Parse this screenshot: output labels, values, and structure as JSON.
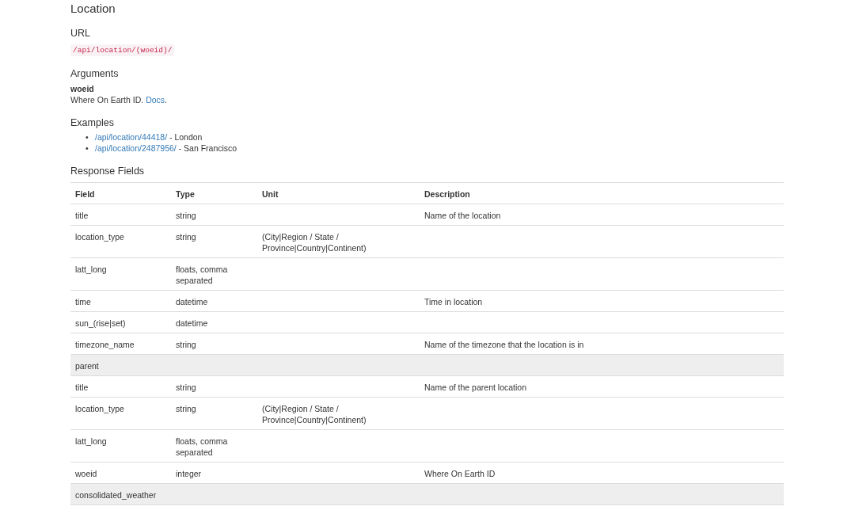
{
  "title": "Location",
  "url": {
    "heading": "URL",
    "path": "/api/location/(woeid)/"
  },
  "arguments": {
    "heading": "Arguments",
    "items": [
      {
        "name": "woeid",
        "description": "Where On Earth ID. ",
        "link": "Docs",
        "after": "."
      }
    ]
  },
  "examples": {
    "heading": "Examples",
    "items": [
      {
        "marker": "•",
        "link": "/api/location/44418/",
        "text": " - London"
      },
      {
        "marker": "•",
        "link": "/api/location/2487956/",
        "text": " - San Francisco"
      }
    ]
  },
  "response_fields": {
    "heading": "Response Fields",
    "columns": [
      "Field",
      "Type",
      "Unit",
      "Description"
    ],
    "rows": [
      {
        "kind": "field",
        "cells": [
          "title",
          "string",
          "",
          "Name of the location"
        ]
      },
      {
        "kind": "field",
        "cells": [
          "location_type",
          "string",
          "(City|Region / State / Province|Country|Continent)",
          ""
        ]
      },
      {
        "kind": "field",
        "cells": [
          "latt_long",
          "floats, comma separated",
          "",
          ""
        ]
      },
      {
        "kind": "field",
        "cells": [
          "time",
          "datetime",
          "",
          "Time in location"
        ]
      },
      {
        "kind": "field",
        "cells": [
          "sun_(rise|set)",
          "datetime",
          "",
          ""
        ]
      },
      {
        "kind": "field",
        "cells": [
          "timezone_name",
          "string",
          "",
          "Name of the timezone that the location is in"
        ]
      },
      {
        "kind": "group",
        "cells": [
          "parent",
          "",
          "",
          ""
        ]
      },
      {
        "kind": "field",
        "cells": [
          "title",
          "string",
          "",
          "Name of the parent location"
        ]
      },
      {
        "kind": "field",
        "cells": [
          "location_type",
          "string",
          "(City|Region / State / Province|Country|Continent)",
          ""
        ]
      },
      {
        "kind": "field",
        "cells": [
          "latt_long",
          "floats, comma separated",
          "",
          ""
        ]
      },
      {
        "kind": "field",
        "cells": [
          "woeid",
          "integer",
          "",
          "Where On Earth ID"
        ]
      },
      {
        "kind": "group",
        "cells": [
          "consolidated_weather",
          "",
          "",
          ""
        ]
      }
    ]
  }
}
